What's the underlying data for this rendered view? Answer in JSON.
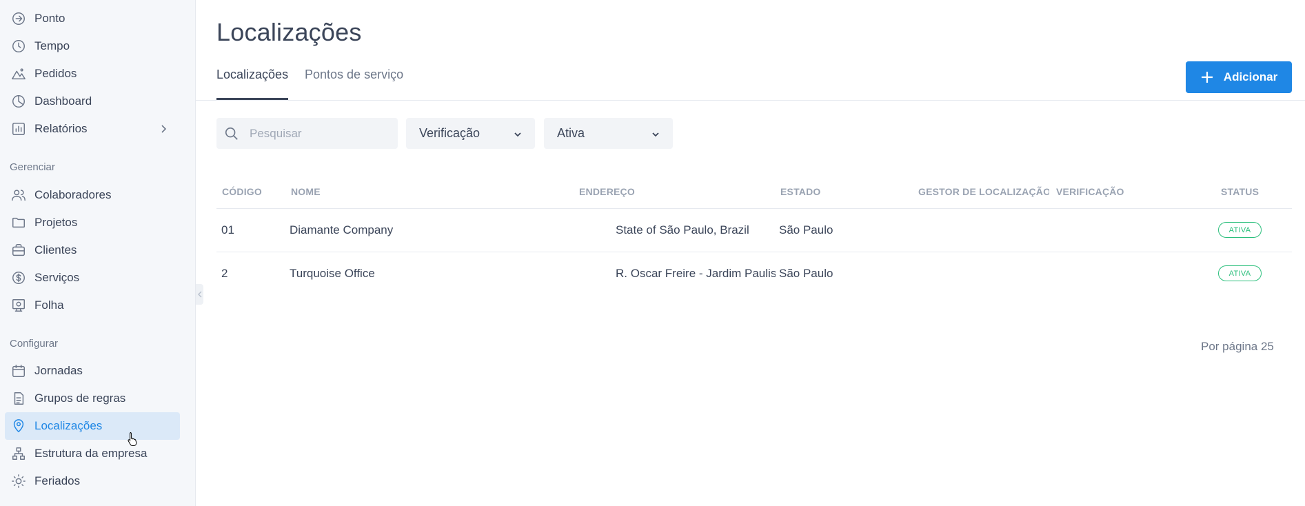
{
  "sidebar": {
    "items_top": [
      {
        "label": "Ponto",
        "icon": "sign-in-icon"
      },
      {
        "label": "Tempo",
        "icon": "clock-icon"
      },
      {
        "label": "Pedidos",
        "icon": "mountain-icon"
      },
      {
        "label": "Dashboard",
        "icon": "pie-chart-icon"
      },
      {
        "label": "Relatórios",
        "icon": "bar-chart-icon"
      }
    ],
    "section_manage": "Gerenciar",
    "items_manage": [
      {
        "label": "Colaboradores",
        "icon": "users-icon"
      },
      {
        "label": "Projetos",
        "icon": "folder-icon"
      },
      {
        "label": "Clientes",
        "icon": "briefcase-icon"
      },
      {
        "label": "Serviços",
        "icon": "dollar-circle-icon"
      },
      {
        "label": "Folha",
        "icon": "payroll-icon"
      }
    ],
    "section_config": "Configurar",
    "items_config": [
      {
        "label": "Jornadas",
        "icon": "calendar-icon"
      },
      {
        "label": "Grupos de regras",
        "icon": "rules-icon"
      },
      {
        "label": "Localizações",
        "icon": "map-pin-icon"
      },
      {
        "label": "Estrutura da empresa",
        "icon": "org-chart-icon"
      },
      {
        "label": "Feriados",
        "icon": "sun-icon"
      }
    ]
  },
  "page": {
    "title": "Localizações",
    "tabs": [
      "Localizações",
      "Pontos de serviço"
    ],
    "add_button": "Adicionar"
  },
  "filters": {
    "search_placeholder": "Pesquisar",
    "verification": "Verificação",
    "status": "Ativa"
  },
  "table": {
    "columns": [
      "CÓDIGO",
      "NOME",
      "ENDEREÇO",
      "ESTADO",
      "GESTOR DE LOCALIZAÇÃO",
      "VERIFICAÇÃO",
      "STATUS"
    ],
    "rows": [
      {
        "code": "01",
        "name": "Diamante Company",
        "address": "State of São Paulo, Brazil",
        "state": "São Paulo",
        "manager": "",
        "verification": "",
        "status": "ATIVA"
      },
      {
        "code": "2",
        "name": "Turquoise Office",
        "address": "R. Oscar Freire - Jardim Paulista",
        "state": "São Paulo",
        "manager": "",
        "verification": "",
        "status": "ATIVA"
      }
    ]
  },
  "pagination": {
    "per_page": "Por página 25"
  },
  "colors": {
    "accent": "#1f87e5",
    "active_bg": "#dbe9f8",
    "status_green": "#2bbf7c"
  }
}
